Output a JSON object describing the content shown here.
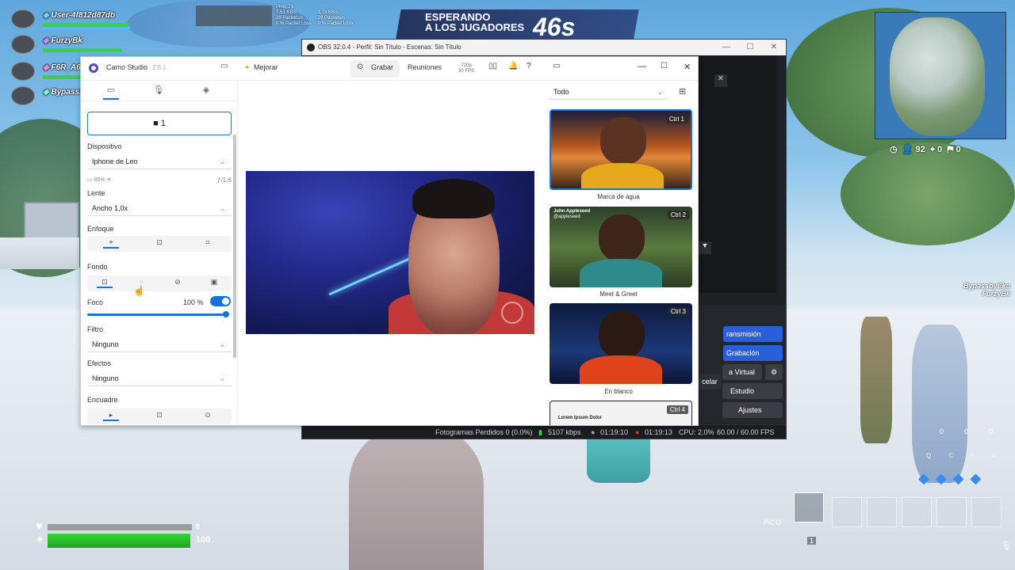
{
  "game": {
    "players": [
      {
        "name": "User-4f812d87db",
        "marker": "◆"
      },
      {
        "name": "FurzyBk",
        "marker": "◆"
      },
      {
        "name": "F6R_A6Y",
        "marker": "◆"
      },
      {
        "name": "BypassbyEko",
        "marker": "◆"
      }
    ],
    "net": {
      "ping": "Ping: 73",
      "down": "7.53 KB/s",
      "down_packets": "29 Packets/s",
      "down_loss": "0 % Packet Loss",
      "up": "1.73 KB/s",
      "up_packets": "29 Packets/s",
      "up_loss": "0 % Packet Loss"
    },
    "banner_line1": "ESPERANDO",
    "banner_line2": "A LOS JUGADORES",
    "countdown": "46s",
    "map_stats": {
      "players": "92",
      "kills": "0",
      "assists": "0"
    },
    "right_names": [
      "BypassbyEko",
      "FurzyBk"
    ],
    "shield_value": "0",
    "health_value": "100",
    "item_label": "PICO",
    "item_count": "1",
    "mats": [
      "0",
      "0",
      "0"
    ],
    "keys": [
      "Q",
      "C",
      "F",
      "V"
    ]
  },
  "obs": {
    "title": "OBS 32.0.4 - Perfil: Sin Título - Escenas: Sin Título",
    "btn_stream": "ransmisión",
    "btn_record": "Grabación",
    "btn_virtual": "a Virtual",
    "btn_studio": "Estudio",
    "btn_settings": "Ajustes",
    "btn_cancel": "celar",
    "status": {
      "dropped": "Fotogramas Perdidos 0 (0.0%)",
      "kbps": "5107 kbps",
      "rec_time": "01:19:10",
      "live_time": "01:19:13",
      "cpu": "CPU: 2.0%",
      "fps": "60.00 / 60.00 FPS"
    }
  },
  "camo": {
    "app_name": "Camo Studio",
    "version": "2.5.1",
    "improve_label": "Mejorar",
    "record_label": "Grabar",
    "meetings_label": "Reuniones",
    "res_line1": "720p",
    "res_line2": "30 FPS",
    "camera_number": "1",
    "device_label": "Dispositivo",
    "device_value": "Iphone de Leo",
    "battery": "95%",
    "aperture": "ƒ/1,6",
    "lens_label": "Lente",
    "lens_value": "Ancho 1,0x",
    "focus_label": "Enfoque",
    "background_label": "Fondo",
    "foco_label": "Foco",
    "foco_value": "100 %",
    "filter_label": "Filtro",
    "filter_value": "Ninguno",
    "effects_label": "Efectos",
    "effects_value": "Ninguno",
    "frame_label": "Encuadre",
    "filter_dropdown": "Todo",
    "presets": [
      {
        "key": "Ctrl",
        "num": "1",
        "caption": "Marca de agua"
      },
      {
        "key": "Ctrl",
        "num": "2",
        "caption": "Meet & Greet",
        "overlay_name": "John Appleseed",
        "overlay_sub": "@appleseed"
      },
      {
        "key": "Ctrl",
        "num": "3",
        "caption": "En blanco"
      },
      {
        "key": "Ctrl",
        "num": "4",
        "overlay_name": "Lorem Ipsum Dolor"
      }
    ]
  }
}
